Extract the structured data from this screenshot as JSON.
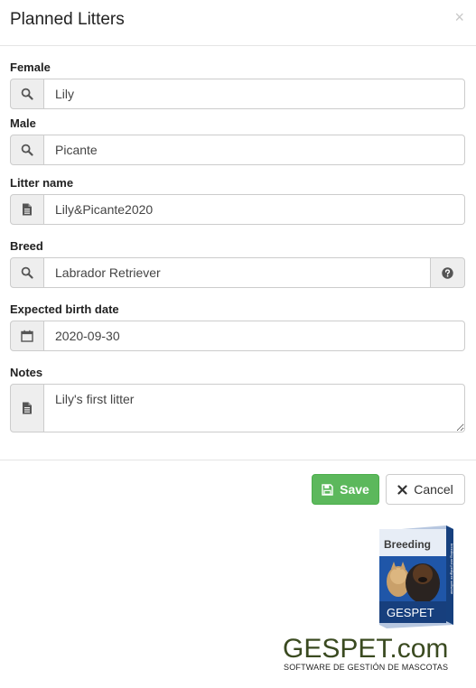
{
  "modal": {
    "title": "Planned Litters",
    "close": "×"
  },
  "fields": {
    "female": {
      "label": "Female",
      "value": "Lily",
      "icon": "search-icon"
    },
    "male": {
      "label": "Male",
      "value": "Picante",
      "icon": "search-icon"
    },
    "litter_name": {
      "label": "Litter name",
      "value": "Lily&Picante2020",
      "icon": "document-icon"
    },
    "breed": {
      "label": "Breed",
      "value": "Labrador Retriever",
      "icon": "search-icon",
      "help_icon": "question-icon"
    },
    "expected_birth_date": {
      "label": "Expected birth date",
      "value": "2020-09-30",
      "icon": "calendar-icon"
    },
    "notes": {
      "label": "Notes",
      "value": "Lily's first litter",
      "icon": "document-icon"
    }
  },
  "buttons": {
    "save": "Save",
    "cancel": "Cancel"
  },
  "branding": {
    "box_title": "Breeding",
    "box_logo": "GESPET",
    "box_side": "breeding and pedigree software",
    "logo": "GESPET.com",
    "tagline": "SOFTWARE DE GESTIÓN DE MASCOTAS"
  },
  "colors": {
    "save_bg": "#5cb85c",
    "addon_bg": "#eeeeee",
    "logo_green": "#3a4a20",
    "box_blue": "#1f56a8"
  }
}
